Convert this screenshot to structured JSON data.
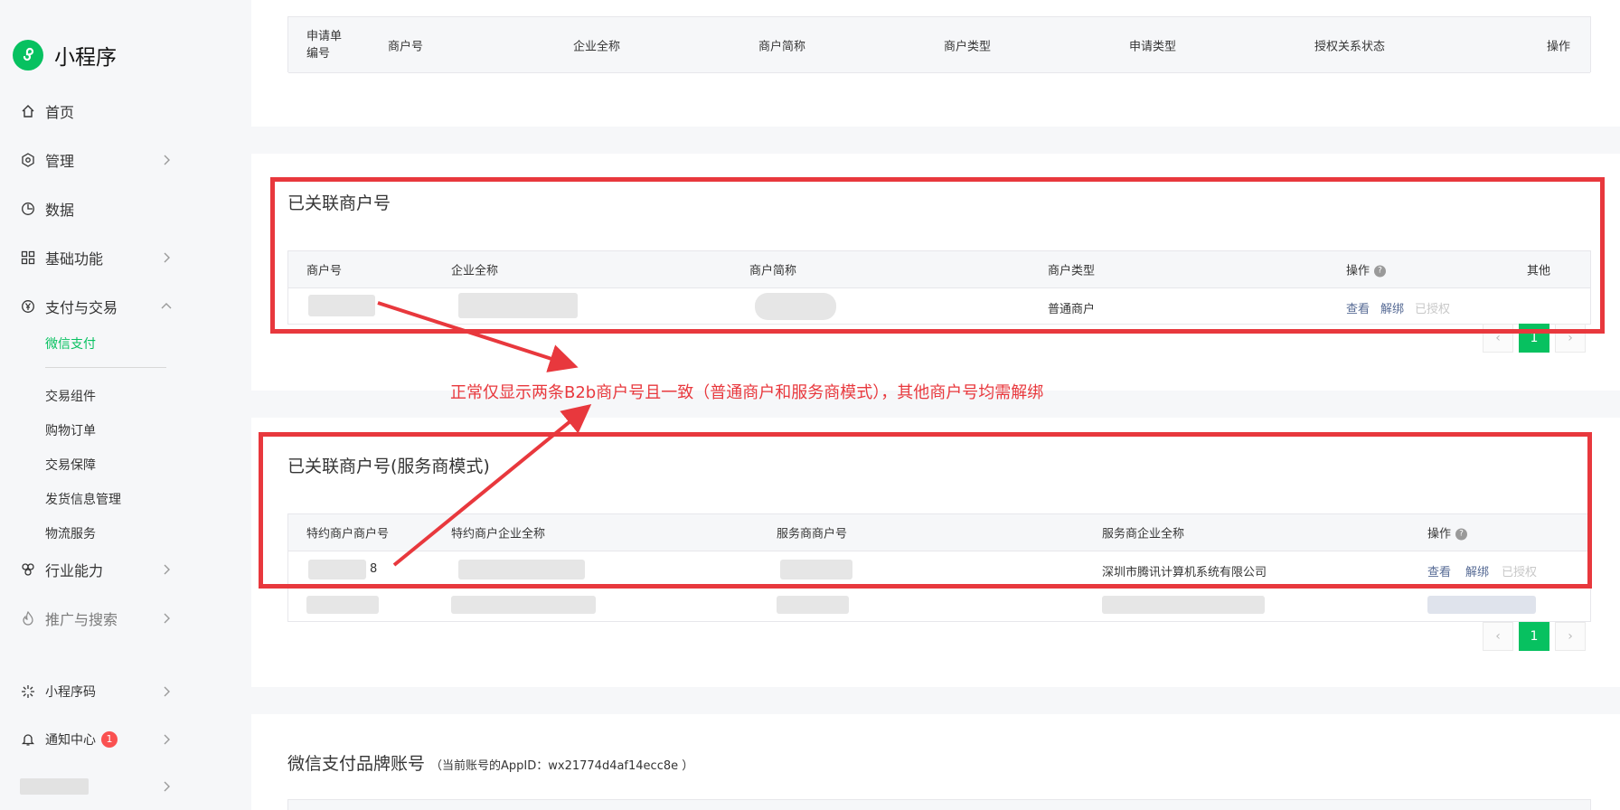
{
  "sidebar": {
    "app_name": "小程序",
    "nav": [
      {
        "label": "首页",
        "icon": "home-icon"
      },
      {
        "label": "管理",
        "icon": "settings-icon"
      },
      {
        "label": "数据",
        "icon": "chart-icon"
      },
      {
        "label": "基础功能",
        "icon": "grid-icon"
      },
      {
        "label": "支付与交易",
        "icon": "yen-icon"
      }
    ],
    "pay_sub": [
      "微信支付",
      "交易组件",
      "购物订单",
      "交易保障",
      "发货信息管理",
      "物流服务"
    ],
    "nav2": [
      {
        "label": "行业能力",
        "icon": "industry-icon"
      },
      {
        "label": "推广与搜索",
        "icon": "promote-icon"
      }
    ],
    "bottom": [
      {
        "label": "小程序码",
        "icon": "qrcode-icon"
      },
      {
        "label": "通知中心",
        "icon": "bell-icon",
        "badge": "1"
      }
    ]
  },
  "apply_table": {
    "headers": [
      "申请单编号",
      "商户号",
      "企业全称",
      "商户简称",
      "商户类型",
      "申请类型",
      "授权关系状态",
      "操作"
    ],
    "header_first_line1": "申请单",
    "header_first_line2": "编号"
  },
  "linked": {
    "title": "已关联商户号",
    "headers": [
      "商户号",
      "企业全称",
      "商户简称",
      "商户类型",
      "操作",
      "其他"
    ],
    "row": {
      "merchant_type": "普通商户",
      "actions": [
        "查看",
        "解绑",
        "已授权"
      ]
    },
    "page": "1"
  },
  "annotation": "正常仅显示两条B2b商户号且一致（普通商户和服务商模式），其他商户号均需解绑",
  "sp_linked": {
    "title": "已关联商户号(服务商模式)",
    "headers": [
      "特约商户商户号",
      "特约商户企业全称",
      "服务商商户号",
      "服务商企业全称",
      "操作"
    ],
    "row": {
      "id_suffix": "8",
      "sp_company": "深圳市腾讯计算机系统有限公司",
      "actions": [
        "查看",
        "解绑",
        "已授权"
      ]
    },
    "page": "1"
  },
  "brand_account": {
    "title": "微信支付品牌账号",
    "appid_note": "（当前账号的AppID：wx21774d4af14ecc8e ）"
  },
  "colors": {
    "accent": "#07c160",
    "annotation": "#e8383d",
    "link": "#576b95"
  }
}
